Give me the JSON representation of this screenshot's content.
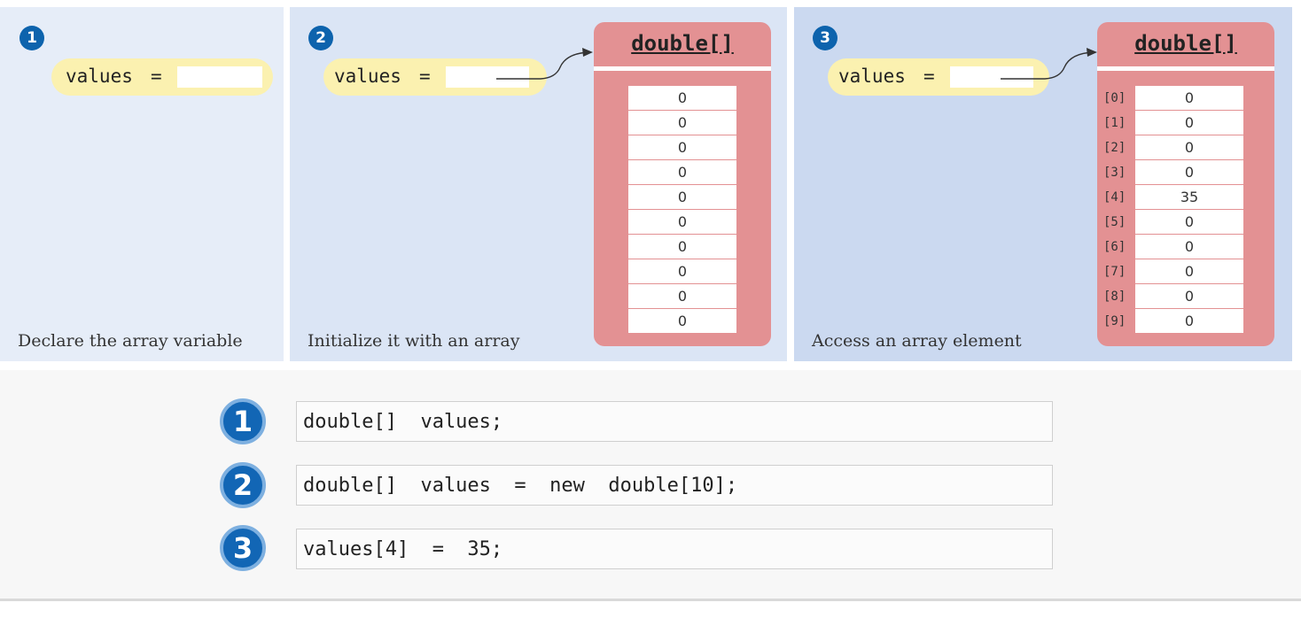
{
  "panels": [
    {
      "step": "1",
      "var_name": "values",
      "equals": "=",
      "caption": "Declare the array variable"
    },
    {
      "step": "2",
      "var_name": "values",
      "equals": "=",
      "caption": "Initialize it with an array",
      "array_title": "double[]",
      "cells": [
        "0",
        "0",
        "0",
        "0",
        "0",
        "0",
        "0",
        "0",
        "0",
        "0"
      ]
    },
    {
      "step": "3",
      "var_name": "values",
      "equals": "=",
      "caption": "Access an array element",
      "array_title": "double[]",
      "indices": [
        "[0]",
        "[1]",
        "[2]",
        "[3]",
        "[4]",
        "[5]",
        "[6]",
        "[7]",
        "[8]",
        "[9]"
      ],
      "cells": [
        "0",
        "0",
        "0",
        "0",
        "35",
        "0",
        "0",
        "0",
        "0",
        "0"
      ]
    }
  ],
  "code": [
    {
      "step": "1",
      "text": "double[]  values;"
    },
    {
      "step": "2",
      "text": "double[]  values  =  new  double[10];"
    },
    {
      "step": "3",
      "text": "values[4]  =  35;"
    }
  ],
  "colors": {
    "badge": "#0d63ad",
    "pill": "#fbf1b0",
    "array": "#e39193"
  }
}
